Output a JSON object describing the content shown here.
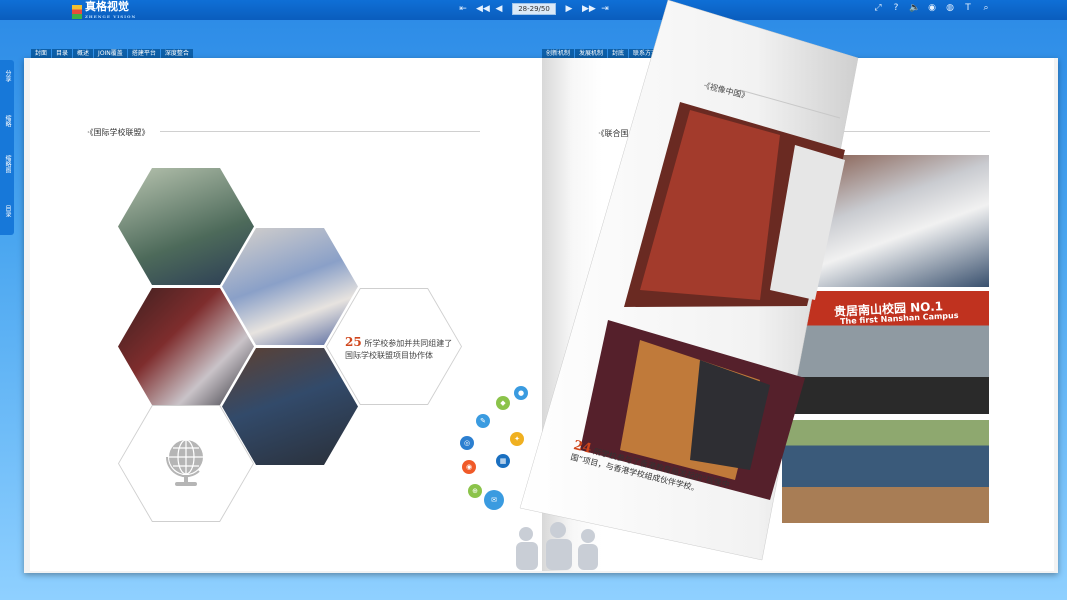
{
  "app": {
    "logo_text": "真格视觉",
    "logo_sub": "ZHENGE VISION",
    "page_indicator": "28-29/50"
  },
  "toolbar": {
    "first_icon": "⇤",
    "prev10_icon": "◀◀",
    "prev_icon": "◀",
    "next_icon": "▶",
    "next10_icon": "▶▶",
    "last_icon": "⇥",
    "fullscreen_icon": "⤢",
    "help_icon": "?",
    "sound_icon": "🔈",
    "autoplay_icon": "◉",
    "share_icon": "◍",
    "text_icon": "T",
    "search_icon": "⌕"
  },
  "sidebar": {
    "items": [
      "分享",
      "缩略",
      "缩略图",
      "目录"
    ]
  },
  "tabs_left": [
    "封面",
    "目录",
    "概述",
    "JOIN覆盖",
    "搭建平台",
    "深度整合"
  ],
  "tabs_right": [
    "创新机制",
    "发展机制",
    "封底",
    "联系方式"
  ],
  "left_page": {
    "section_title": "·《国际学校联盟》",
    "stat_number": "25",
    "stat_text": "所学校参加并共同组建了国际学校联盟项目协作体"
  },
  "right_page": {
    "section_title": "·《联合国",
    "flip_title": "·《视像中国》",
    "banner_text": "贵居南山校园 NO.1",
    "banner_sub": "The first Nanshan Campus",
    "stat_number": "24",
    "stat_text": "所学校参与了香港教育局发起的“视像中国”项目，与香港学校组成伙伴学校。"
  },
  "nav": {
    "left_arrow": "‹",
    "right_arrow": "›"
  }
}
